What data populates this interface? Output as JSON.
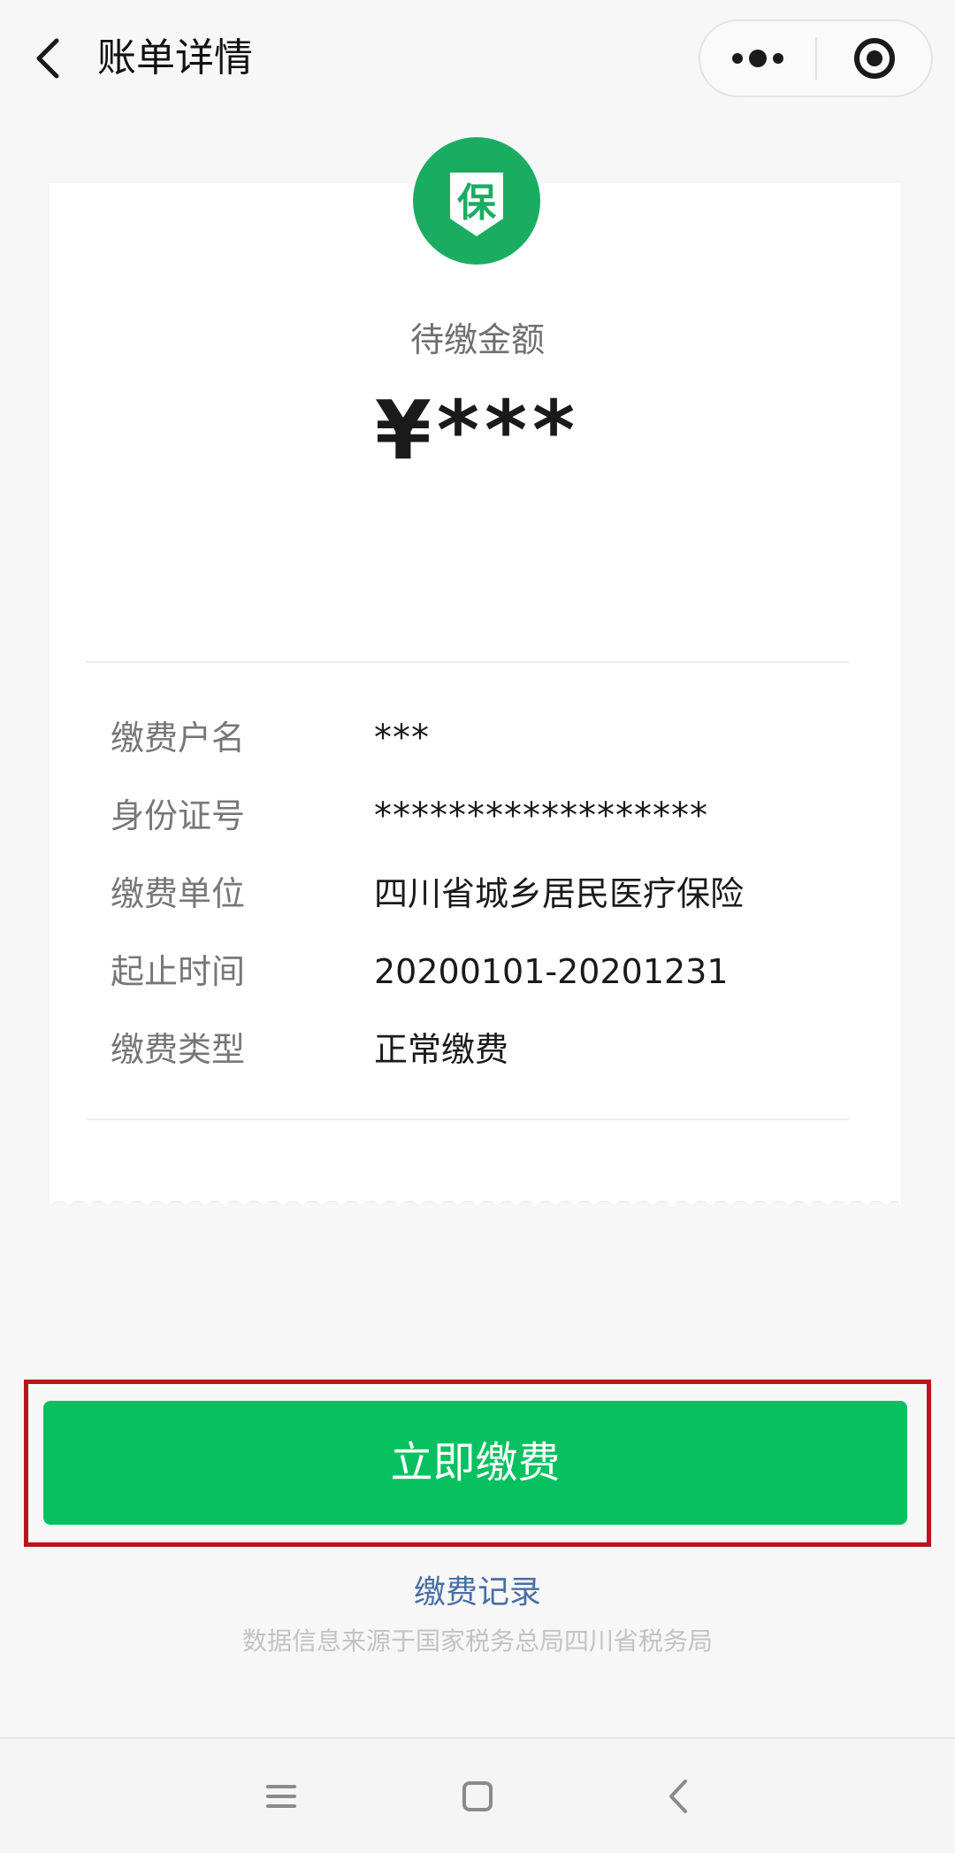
{
  "header": {
    "title": "账单详情",
    "back_icon": "chevron-left-icon",
    "more_icon": "more-dots-icon",
    "close_icon": "target-close-icon"
  },
  "bill": {
    "badge_char": "保",
    "amount_label": "待缴金额",
    "amount": "¥***",
    "rows": [
      {
        "label": "缴费户名",
        "value": "***"
      },
      {
        "label": "身份证号",
        "value": "******************"
      },
      {
        "label": "缴费单位",
        "value": "四川省城乡居民医疗保险"
      },
      {
        "label": "起止时间",
        "value": "20200101-20201231"
      },
      {
        "label": "缴费类型",
        "value": "正常缴费"
      }
    ]
  },
  "actions": {
    "pay_label": "立即缴费",
    "records_label": "缴费记录",
    "source_note": "数据信息来源于国家税务总局四川省税务局"
  },
  "system_nav": {
    "menu_icon": "menu-lines-icon",
    "home_icon": "home-square-icon",
    "back_icon": "back-chevron-icon"
  },
  "colors": {
    "brand_green": "#07c160",
    "badge_green": "#1aad62",
    "highlight_frame": "#b8161c",
    "link_blue": "#4a6ea5"
  }
}
